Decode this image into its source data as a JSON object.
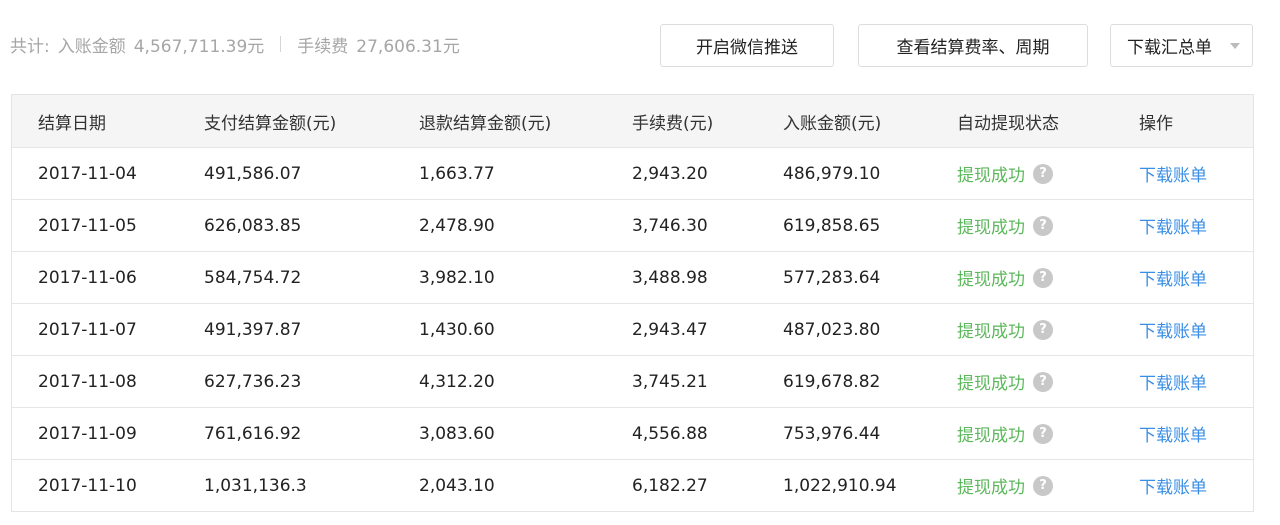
{
  "summary": {
    "total_label": "共计:",
    "income_label": "入账金额",
    "income_value": "4,567,711.39元",
    "fee_label": "手续费",
    "fee_value": "27,606.31元"
  },
  "toolbar": {
    "wechat_push_label": "开启微信推送",
    "rate_period_label": "查看结算费率、周期",
    "download_summary_label": "下载汇总单"
  },
  "colors": {
    "status_success": "#5cb85c",
    "link": "#3a8ee6"
  },
  "table": {
    "columns": [
      "结算日期",
      "支付结算金额(元)",
      "退款结算金额(元)",
      "手续费(元)",
      "入账金额(元)",
      "自动提现状态",
      "操作"
    ],
    "rows": [
      {
        "date": "2017-11-04",
        "pay": "491,586.07",
        "refund": "1,663.77",
        "fee": "2,943.20",
        "income": "486,979.10",
        "status": "提现成功",
        "action": "下载账单"
      },
      {
        "date": "2017-11-05",
        "pay": "626,083.85",
        "refund": "2,478.90",
        "fee": "3,746.30",
        "income": "619,858.65",
        "status": "提现成功",
        "action": "下载账单"
      },
      {
        "date": "2017-11-06",
        "pay": "584,754.72",
        "refund": "3,982.10",
        "fee": "3,488.98",
        "income": "577,283.64",
        "status": "提现成功",
        "action": "下载账单"
      },
      {
        "date": "2017-11-07",
        "pay": "491,397.87",
        "refund": "1,430.60",
        "fee": "2,943.47",
        "income": "487,023.80",
        "status": "提现成功",
        "action": "下载账单"
      },
      {
        "date": "2017-11-08",
        "pay": "627,736.23",
        "refund": "4,312.20",
        "fee": "3,745.21",
        "income": "619,678.82",
        "status": "提现成功",
        "action": "下载账单"
      },
      {
        "date": "2017-11-09",
        "pay": "761,616.92",
        "refund": "3,083.60",
        "fee": "4,556.88",
        "income": "753,976.44",
        "status": "提现成功",
        "action": "下载账单"
      },
      {
        "date": "2017-11-10",
        "pay": "1,031,136.3",
        "refund": "2,043.10",
        "fee": "6,182.27",
        "income": "1,022,910.94",
        "status": "提现成功",
        "action": "下载账单"
      }
    ],
    "help_icon_glyph": "?"
  }
}
